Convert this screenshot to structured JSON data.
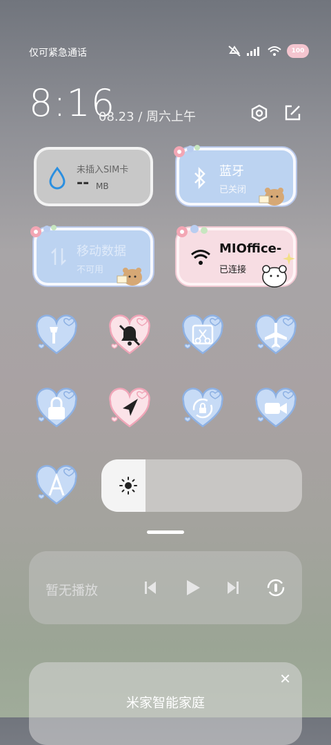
{
  "status": {
    "carrier_text": "仅可紧急通话",
    "battery": "100"
  },
  "clock": {
    "time": "8:16",
    "date": "08.23 / 周六上午"
  },
  "tiles": {
    "sim": {
      "label": "未插入SIM卡",
      "value": "--",
      "unit": "MB"
    },
    "bluetooth": {
      "label": "蓝牙",
      "status": "已关闭"
    },
    "mobile_data": {
      "label": "移动数据",
      "status": "不可用"
    },
    "wifi": {
      "label": "MIOffice-",
      "status": "已连接"
    }
  },
  "toggles": [
    {
      "name": "flashlight",
      "icon": "flashlight-icon",
      "active": false
    },
    {
      "name": "mute",
      "icon": "bell-off-icon",
      "active": true
    },
    {
      "name": "screenshot",
      "icon": "scissors-icon",
      "active": false
    },
    {
      "name": "airplane",
      "icon": "airplane-icon",
      "active": false
    },
    {
      "name": "lock-screen",
      "icon": "lock-icon",
      "active": false
    },
    {
      "name": "location",
      "icon": "location-arrow-icon",
      "active": true
    },
    {
      "name": "auto-rotate",
      "icon": "rotate-lock-icon",
      "active": false
    },
    {
      "name": "screen-record",
      "icon": "video-camera-icon",
      "active": false
    },
    {
      "name": "auto-brightness",
      "icon": "letter-a-icon",
      "active": false
    }
  ],
  "brightness": {
    "level": 0.22
  },
  "media": {
    "text": "暂无播放"
  },
  "smart_home": {
    "title": "米家智能家庭"
  },
  "colors": {
    "heart_blue": "#c7dbf6",
    "heart_pink": "#fbe3e8",
    "heart_blue_border": "#8eb1e3",
    "heart_pink_border": "#f0a6b8"
  }
}
